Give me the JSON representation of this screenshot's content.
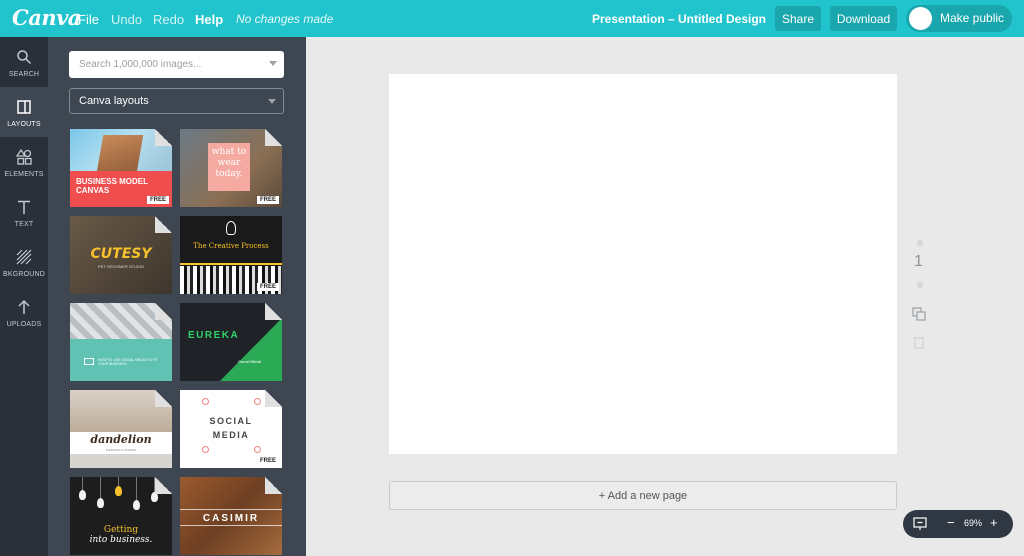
{
  "topbar": {
    "logo": "Canva",
    "menu": [
      "File",
      "Undo",
      "Redo",
      "Help"
    ],
    "status": "No changes made",
    "doc_title": "Presentation – Untitled Design",
    "share": "Share",
    "download": "Download",
    "make_public": "Make public"
  },
  "rail": {
    "items": [
      "SEARCH",
      "LAYOUTS",
      "ELEMENTS",
      "TEXT",
      "BKGROUND",
      "UPLOADS"
    ],
    "active": "LAYOUTS"
  },
  "panel": {
    "search_placeholder": "Search 1,000,000 images...",
    "dropdown_value": "Canva layouts",
    "free_badge": "FREE",
    "thumbs": {
      "t1": [
        "BUSINESS MODEL",
        "CANVAS"
      ],
      "t2": [
        "what to",
        "wear",
        "today."
      ],
      "t3": "CUTESY",
      "t3_sub": "PET GROOMER STUDIO",
      "t4": "The Creative Process",
      "t5": "HOW TO USE SOCIAL MEDIA TO FIT YOUR BUSINESS",
      "t6": "EUREKA",
      "t6_sub": "GameOfficial",
      "t7": "dandelion",
      "t7_sub": "WEDDING FLOWERS",
      "t8": [
        "SOCIAL",
        "MEDIA"
      ],
      "t9": [
        "Getting",
        "into business."
      ],
      "t10": "CASIMIR"
    }
  },
  "canvas": {
    "page_number": "1",
    "add_page": "+ Add a new page",
    "zoom": "69%"
  },
  "colors": {
    "topbar": "#21c4cc",
    "rail": "#293039",
    "panel": "#3e4651",
    "workspace": "#e9e9e9"
  }
}
